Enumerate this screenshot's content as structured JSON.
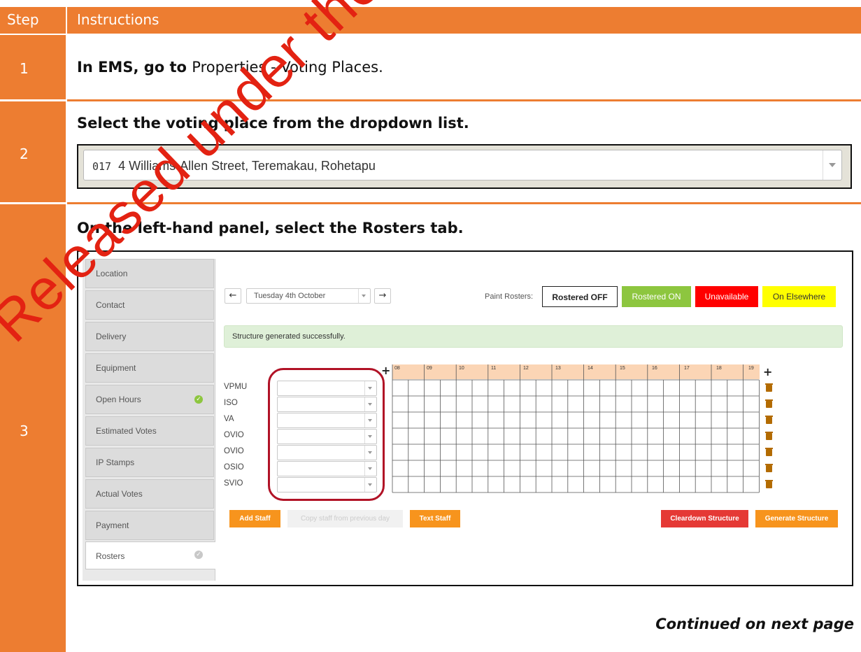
{
  "table": {
    "header_step": "Step",
    "header_instructions": "Instructions"
  },
  "steps": [
    {
      "number": "1",
      "instr_bold": "In EMS, go to",
      "instr_normal": "Properties - Voting Places."
    },
    {
      "number": "2",
      "instr_bold": "Select the voting place from the dropdown list."
    },
    {
      "number": "3",
      "instr_bold": "On the left-hand panel, select the Rosters tab."
    }
  ],
  "voting_place_select": {
    "code": "017",
    "address": "4 Williams-Allen Street, Teremakau, Rohetapu"
  },
  "app": {
    "tabs": [
      "Location",
      "Contact",
      "Delivery",
      "Equipment",
      "Open Hours",
      "Estimated Votes",
      "IP Stamps",
      "Actual Votes",
      "Payment",
      "Rosters"
    ],
    "date": "Tuesday 4th October",
    "paint_label": "Paint Rosters:",
    "paint": {
      "off": "Rostered OFF",
      "on": "Rostered ON",
      "unavailable": "Unavailable",
      "elsewhere": "On Elsewhere"
    },
    "status": "Structure generated successfully.",
    "roles": [
      "VPMU",
      "ISO",
      "VA",
      "OVIO",
      "OVIO",
      "OSIO",
      "SVIO"
    ],
    "hours": [
      "08",
      "09",
      "10",
      "11",
      "12",
      "13",
      "14",
      "15",
      "16",
      "17",
      "18",
      "19"
    ],
    "buttons": {
      "add_staff": "Add Staff",
      "copy_staff": "Copy staff from previous day",
      "text_staff": "Text Staff",
      "cleardown": "Cleardown Structure",
      "generate": "Generate Structure"
    },
    "colors": {
      "rostered_on": "#8dc63f",
      "unavailable": "#ff0000",
      "elsewhere": "#ffff00",
      "orange_btn": "#f7941d",
      "red_btn": "#e53935",
      "status_bg": "#dff0d8",
      "hour_bg": "#fbd5b5"
    }
  },
  "footer": "Continued on next page",
  "watermark": "Released under the Official"
}
